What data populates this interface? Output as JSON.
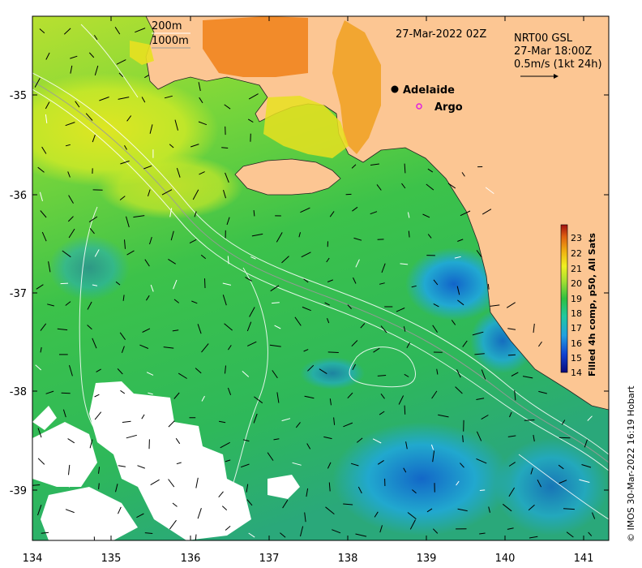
{
  "map": {
    "date_label": "27-Mar-2022 02Z",
    "product_label": "NRT00 GSL",
    "current_time_label": "27-Mar 18:00Z",
    "current_scale_label": "0.5m/s (1kt 24h)",
    "isobath_labels": [
      "200m",
      "1000m"
    ],
    "credit": "© IMOS 30-Mar-2022 16:19 Hobart",
    "colors": {
      "land": "#fcc693",
      "sst_cold": "#0a1a8c",
      "sst_mid": "#22c44a",
      "sst_warm": "#f0a018"
    }
  },
  "places": [
    {
      "name": "Adelaide",
      "lon": 138.6,
      "lat": -34.93,
      "marker": "filled-circle",
      "color": "#000000"
    },
    {
      "name": "Argo",
      "lon": 138.88,
      "lat": -35.12,
      "marker": "open-circle",
      "color": "#e020e0"
    }
  ],
  "axes": {
    "x_ticks": [
      "134",
      "135",
      "136",
      "137",
      "138",
      "139",
      "140",
      "141"
    ],
    "y_ticks": [
      "-35",
      "-36",
      "-37",
      "-38",
      "-39"
    ],
    "xlim": [
      134,
      141.3
    ],
    "ylim": [
      -39.5,
      -34.2
    ]
  },
  "colorbar": {
    "title": "Filled 4h comp, p50, All Sats",
    "ticks": [
      "23",
      "22",
      "21",
      "20",
      "19",
      "18",
      "17",
      "16",
      "15",
      "14"
    ],
    "range": [
      14,
      23.5
    ]
  }
}
